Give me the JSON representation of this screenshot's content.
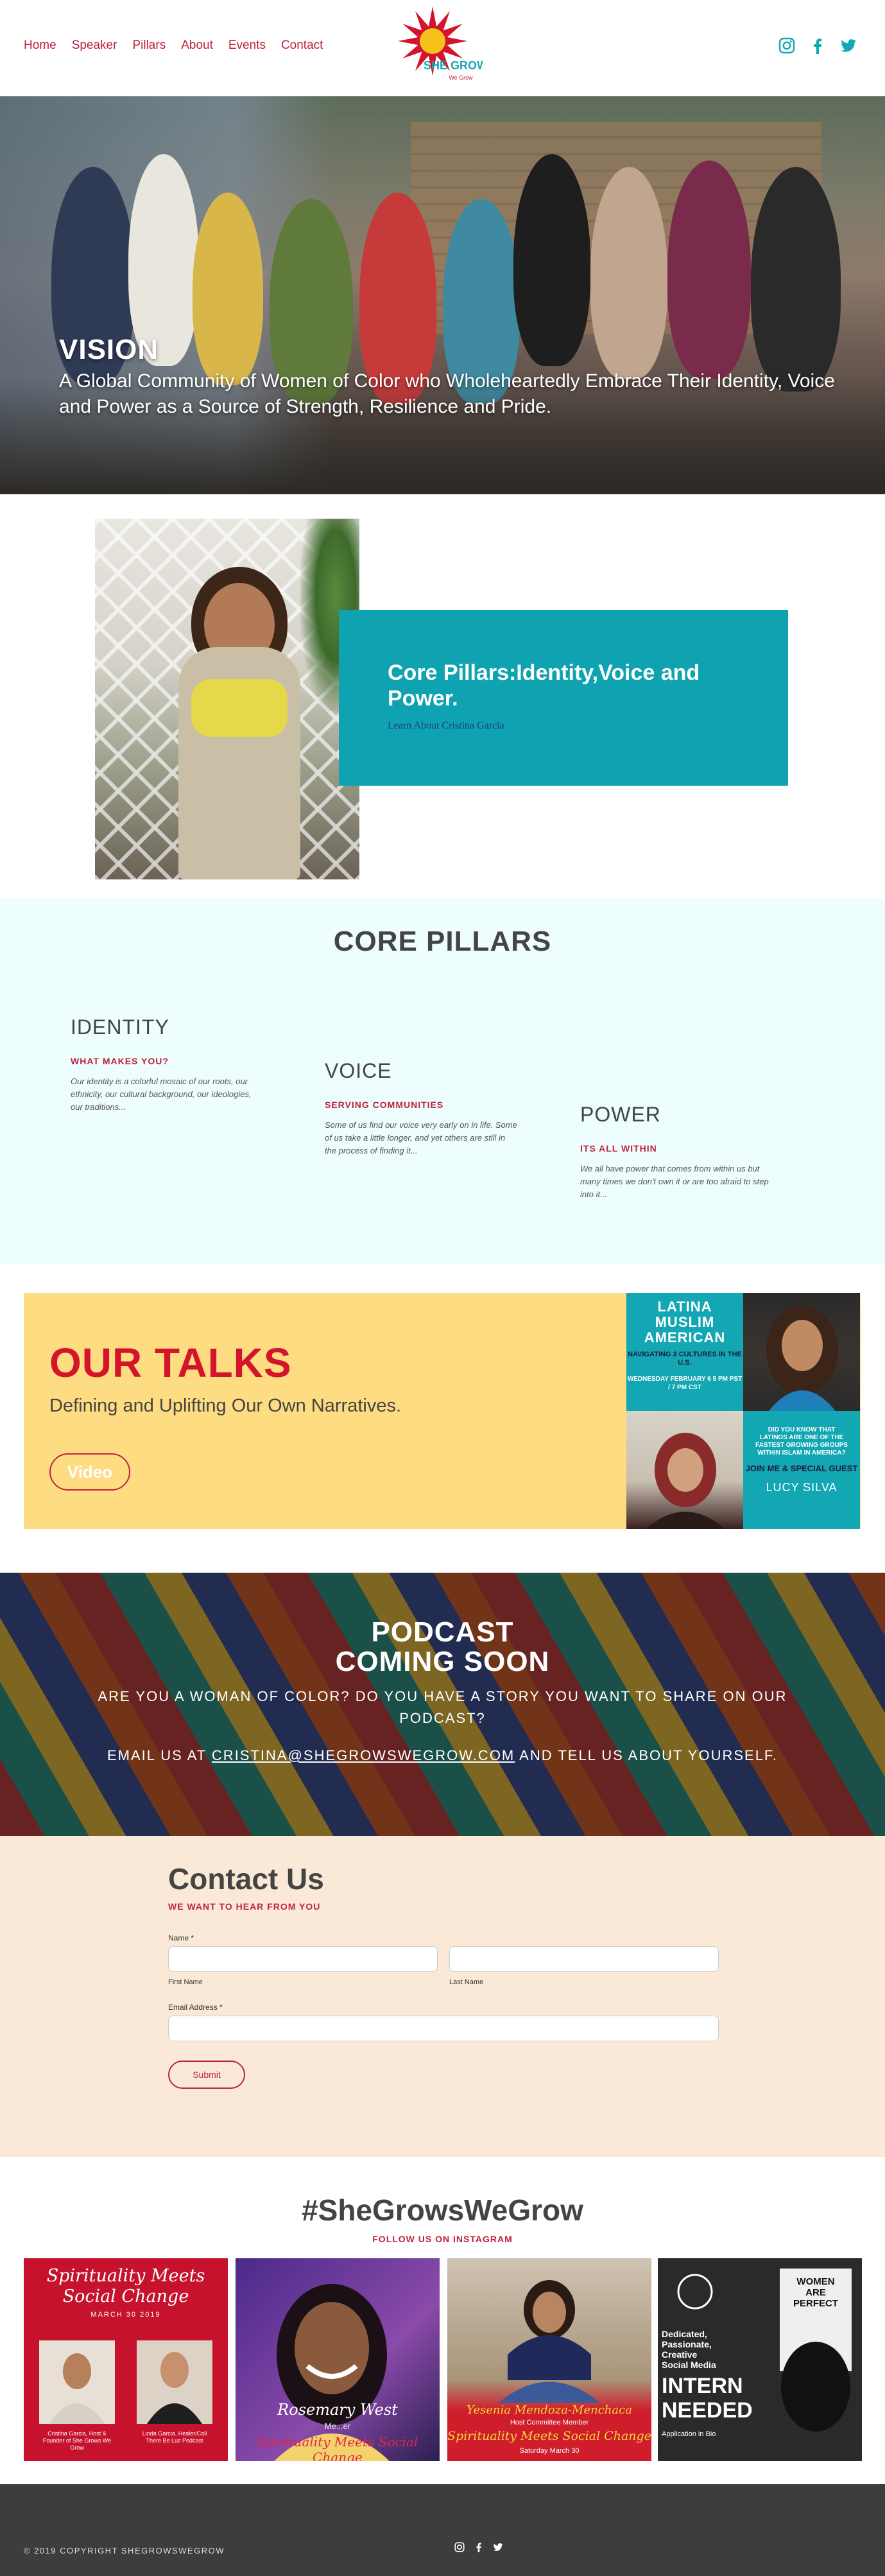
{
  "header": {
    "nav": [
      "Home",
      "Speaker",
      "Pillars",
      "About",
      "Events",
      "Contact"
    ],
    "logo_text": "SHE GROWS",
    "logo_tagline": "We Grow",
    "social_icons": [
      "instagram-icon",
      "facebook-icon",
      "twitter-icon"
    ],
    "accent_color": "#c0213c",
    "social_color": "#13a7b3"
  },
  "hero": {
    "title": "VISION",
    "subtitle": "A Global Community of Women of Color who Wholeheartedly Embrace Their Identity, Voice and Power as a Source of Strength, Resilience and Pride."
  },
  "feature": {
    "title": "Core Pillars:Identity,Voice and Power.",
    "link": "Learn About Cristina Garcia",
    "card_color": "#0fa3b1"
  },
  "pillars": {
    "title": "CORE PILLARS",
    "items": [
      {
        "name": "IDENTITY",
        "subtitle": "WHAT MAKES YOU?",
        "text": "Our identity is a colorful mosaic of our roots, our ethnicity, our cultural background, our ideologies, our traditions..."
      },
      {
        "name": "VOICE",
        "subtitle": "SERVING COMMUNITIES",
        "text": "Some of us find our voice very early on in life. Some of us take a little longer, and yet others are still in the process of finding it..."
      },
      {
        "name": "POWER",
        "subtitle": "ITS ALL WITHIN",
        "text": "We all have power that comes from within us but many times we don't own it or are too afraid to step into it..."
      }
    ]
  },
  "talks": {
    "title": "OUR TALKS",
    "subtitle": "Defining and Uplifting Our Own Narratives.",
    "button": "Video",
    "collage": {
      "heading": "LATINA MUSLIM AMERICAN",
      "subheading": "NAVIGATING 3 CULTURES IN THE U.S.",
      "date": "WEDNESDAY FEBRUARY 6 5 PM PST / 7 PM CST",
      "question": "DID YOU KNOW THAT LATINOS ARE ONE OF THE FASTEST GROWING GROUPS WITHIN ISLAM IN AMERICA?",
      "join": "JOIN ME & SPECIAL GUEST",
      "guest": "LUCY SILVA"
    }
  },
  "podcast": {
    "title_line1": "PODCAST",
    "title_line2": "COMING SOON",
    "question": "ARE YOU A WOMAN OF COLOR? DO YOU HAVE A STORY YOU WANT TO SHARE ON OUR PODCAST?",
    "email_prefix": "EMAIL US AT",
    "email": "CRISTINA@SHEGROWSWEGROW.COM",
    "email_suffix": "AND TELL US ABOUT YOURSELF."
  },
  "contact": {
    "title": "Contact Us",
    "subtitle": "WE WANT TO HEAR FROM YOU",
    "name_label": "Name *",
    "first_name_hint": "First Name",
    "last_name_hint": "Last Name",
    "email_label": "Email Address *",
    "submit": "Submit",
    "background": "#fae9d6"
  },
  "instagram": {
    "title": "#SheGrowsWeGrow",
    "subtitle": "FOLLOW US ON INSTAGRAM",
    "tile1_title": "Spirituality Meets Social Change",
    "tile1_date": "MARCH 30 2019",
    "tile1_p1": "Cristina Garcia, Host & Founder of She Grows We Grow",
    "tile1_p2": "Linda Garcia, Healer/Call There Be Luz Podcast",
    "tile2_name": "Rosemary West",
    "tile2_role": "Me...er",
    "tile2_event": "Spirituality Meets Social Change",
    "tile3_name": "Yesenia Mendoza-Menchaca",
    "tile3_role": "Host Committee Member",
    "tile3_event": "Spirituality Meets Social Change",
    "tile3_date": "Saturday March 30",
    "tile4_lines": [
      "Dedicated,",
      "Passionate,",
      "Creative",
      "Social Media"
    ],
    "tile4_big": "INTERN NEEDED",
    "tile4_sign": "WOMEN ARE PERFECT",
    "tile4_note": "Application in Bio"
  },
  "footer": {
    "copyright": "© 2019 COPYRIGHT SHEGROWSWEGROW",
    "social_icons": [
      "instagram-icon",
      "facebook-icon",
      "twitter-icon"
    ]
  }
}
